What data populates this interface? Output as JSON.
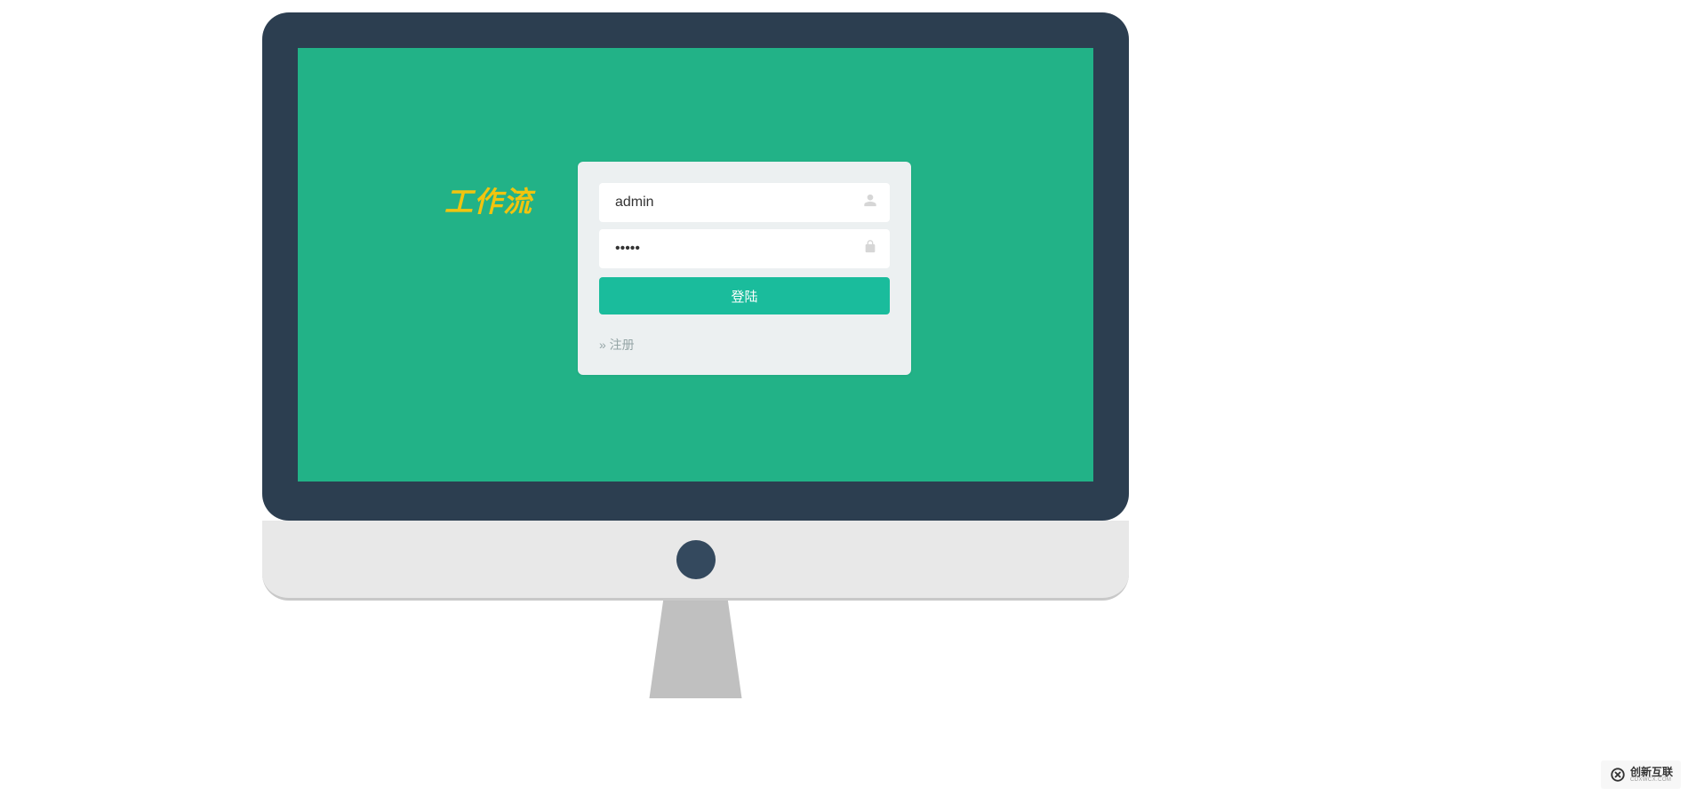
{
  "app": {
    "title": "工作流"
  },
  "login": {
    "username_value": "admin",
    "password_value": "•••••",
    "submit_label": "登陆",
    "register_label": "» 注册"
  },
  "watermark": {
    "brand": "创新互联",
    "sub": "CDXWCX.COM"
  }
}
